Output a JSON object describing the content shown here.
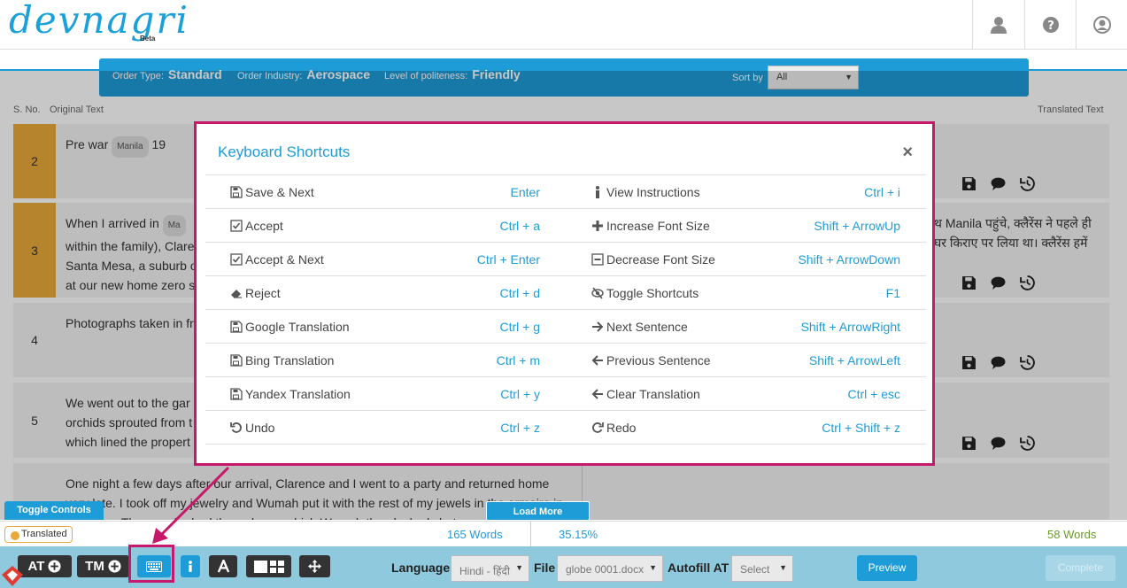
{
  "header": {
    "logo": "devnagri",
    "beta": "Beta",
    "icons": [
      "user-icon",
      "help-icon",
      "account-icon"
    ]
  },
  "order": {
    "type_label": "Order Type:",
    "type_value": "Standard",
    "industry_label": "Order Industry:",
    "industry_value": "Aerospace",
    "politeness_label": "Level of politeness:",
    "politeness_value": "Friendly",
    "sort_label": "Sort by",
    "sort_value": "All"
  },
  "columns": {
    "sno": "S. No.",
    "original": "Original Text",
    "translated": "Translated Text"
  },
  "rows": [
    {
      "num": "2",
      "src": "Pre war",
      "chip": "Manila",
      "src_tail": "19",
      "tgt": ""
    },
    {
      "num": "3",
      "src_lines": [
        "When I arrived in",
        "within the family), Clare",
        "Santa Mesa, a suburb o",
        "at our new home zero s"
      ],
      "chip": "Ma",
      "tgt_lines": [
        "थ Manila पहुंचे, क्लैरेंस ने पहले ही",
        "घर किराए पर लिया था। क्लैरेंस हमें"
      ]
    },
    {
      "num": "4",
      "src": "Photographs taken in fr",
      "tgt": ""
    },
    {
      "num": "5",
      "src_lines": [
        "We went out to the gar",
        "orchids sprouted from t",
        "which lined the propert"
      ],
      "tgt": ""
    },
    {
      "num": "",
      "src_lines": [
        "One night a few days after our arrival, Clarence and I went to a party and returned home",
        "very late. I took off my jewelry and Wumah put it with the rest of my jewels in the armoire in",
        "bedroom. The armoire had three doors, which Wumah then locked shut."
      ]
    }
  ],
  "modal": {
    "title": "Keyboard Shortcuts",
    "close": "×",
    "shortcuts": [
      {
        "l1": "Save & Next",
        "i1": "save-icon",
        "k1": "Enter",
        "l2": "View Instructions",
        "i2": "info-icon",
        "k2": "Ctrl + i"
      },
      {
        "l1": "Accept",
        "i1": "checkbox-icon",
        "k1": "Ctrl + a",
        "l2": "Increase Font Size",
        "i2": "plus-icon",
        "k2": "Shift + ArrowUp"
      },
      {
        "l1": "Accept & Next",
        "i1": "checkbox-icon",
        "k1": "Ctrl + Enter",
        "l2": "Decrease Font Size",
        "i2": "minus-square-icon",
        "k2": "Shift + ArrowDown"
      },
      {
        "l1": "Reject",
        "i1": "eraser-icon",
        "k1": "Ctrl + d",
        "l2": "Toggle Shortcuts",
        "i2": "eye-slash-icon",
        "k2": "F1"
      },
      {
        "l1": "Google Translation",
        "i1": "save-icon",
        "k1": "Ctrl + g",
        "l2": "Next Sentence",
        "i2": "arrow-right-icon",
        "k2": "Shift + ArrowRight"
      },
      {
        "l1": "Bing Translation",
        "i1": "save-icon",
        "k1": "Ctrl + m",
        "l2": "Previous Sentence",
        "i2": "arrow-left-icon",
        "k2": "Shift + ArrowLeft"
      },
      {
        "l1": "Yandex Translation",
        "i1": "save-icon",
        "k1": "Ctrl + y",
        "l2": "Clear Translation",
        "i2": "arrow-left-icon",
        "k2": "Ctrl + esc"
      },
      {
        "l1": "Undo",
        "i1": "undo-icon",
        "k1": "Ctrl + z",
        "l2": "Redo",
        "i2": "redo-icon",
        "k2": "Ctrl + Shift + z"
      }
    ]
  },
  "controls": {
    "toggle": "Toggle Controls",
    "load_more": "Load More",
    "translated": "Translated",
    "words_left": "165 Words",
    "percent": "35.15%",
    "words_right": "58 Words"
  },
  "toolbar": {
    "at": "AT",
    "tm": "TM",
    "language_label": "Language",
    "language_value": "Hindi - हिंदी",
    "file_label": "File",
    "file_value": "globe 0001.docx",
    "autofill_label": "Autofill AT",
    "autofill_value": "Select",
    "preview": "Preview",
    "complete": "Complete"
  },
  "colors": {
    "brand": "#1e9cd7",
    "accent": "#c8186b",
    "done": "#e8a93a"
  }
}
